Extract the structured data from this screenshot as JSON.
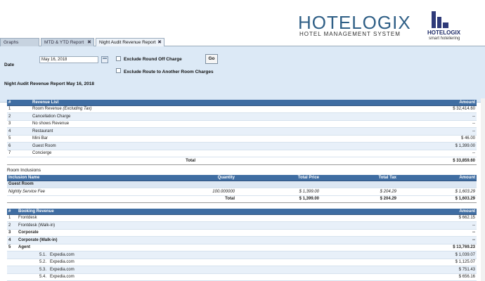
{
  "brand": {
    "title": "HOTELOGIX",
    "subtitle": "HOTEL MANAGEMENT SYSTEM",
    "logo_name": "HOTELOGIX",
    "logo_tagline": "smart hoteliering"
  },
  "tabs": [
    {
      "label": "Graphs"
    },
    {
      "label": "MTD & YTD Report"
    },
    {
      "label": "Night Audit Revenue Report"
    }
  ],
  "params": {
    "date_label": "Date",
    "date_value": "May 16, 2018",
    "exclude_roundoff_label": "Exclude Round Off Charge",
    "exclude_route_label": "Exclude Route to Another Room Charges",
    "go_label": "Go",
    "report_title": "Night Audit Revenue Report  May 16, 2018"
  },
  "revenue": {
    "headers": [
      "#",
      "Revenue List",
      "Amount"
    ],
    "rows": [
      {
        "n": "1",
        "name": "Room Revenue ",
        "name_em": "(Excluding Tax)",
        "amount": "$ 32,414.60"
      },
      {
        "n": "2",
        "name": "Cancellation Charge",
        "name_em": "",
        "amount": "--"
      },
      {
        "n": "3",
        "name": "No shows Revenue",
        "name_em": "",
        "amount": "--"
      },
      {
        "n": "4",
        "name": "Restaurant",
        "name_em": "",
        "amount": "--"
      },
      {
        "n": "5",
        "name": "Mini Bar",
        "name_em": "",
        "amount": "$ 46.00"
      },
      {
        "n": "6",
        "name": "Guest Room",
        "name_em": "",
        "amount": "$ 1,399.00"
      },
      {
        "n": "7",
        "name": "Concierge",
        "name_em": "",
        "amount": "--"
      }
    ],
    "total_label": "Total",
    "total_amount": "$ 33,859.60"
  },
  "room_inclusions": {
    "label": "Room Inclusions",
    "headers": [
      "Inclusion Name",
      "Quantity",
      "Total Price",
      "Total Tax",
      "Amount"
    ],
    "group": "Guest Room",
    "rows": [
      {
        "name": "Nightly Service Fee",
        "qty": "100.000000",
        "price": "$ 1,399.00",
        "tax": "$ 204.29",
        "amount": "$ 1,603.29"
      }
    ],
    "total_label": "Total",
    "total_price": "$ 1,399.00",
    "total_tax": "$ 204.29",
    "total_amount": "$ 1,603.29"
  },
  "booking": {
    "headers": [
      "#",
      "Booking Revenue",
      "Amount"
    ],
    "rows": [
      {
        "n": "1",
        "name": "Frontdesk",
        "amount": "$ 662.15",
        "bold": false
      },
      {
        "n": "2",
        "name": "Frontdesk (Walk-in)",
        "amount": "--",
        "bold": false
      },
      {
        "n": "3",
        "name": "Corporate",
        "amount": "--",
        "bold": true
      },
      {
        "n": "4",
        "name": "Corporate (Walk-in)",
        "amount": "--",
        "bold": true
      },
      {
        "n": "5",
        "name": "Agent",
        "amount": "$ 13,769.23",
        "bold": true
      }
    ],
    "subrows": [
      {
        "n": "5.1.",
        "name": "Expedia.com",
        "amount": "$ 1,039.07"
      },
      {
        "n": "5.2.",
        "name": "Expedia.com",
        "amount": "$ 1,125.07"
      },
      {
        "n": "5.3.",
        "name": "Expedia.com",
        "amount": "$ 751.43"
      },
      {
        "n": "5.4.",
        "name": "Expedia.com",
        "amount": "$ 656.16"
      }
    ]
  }
}
